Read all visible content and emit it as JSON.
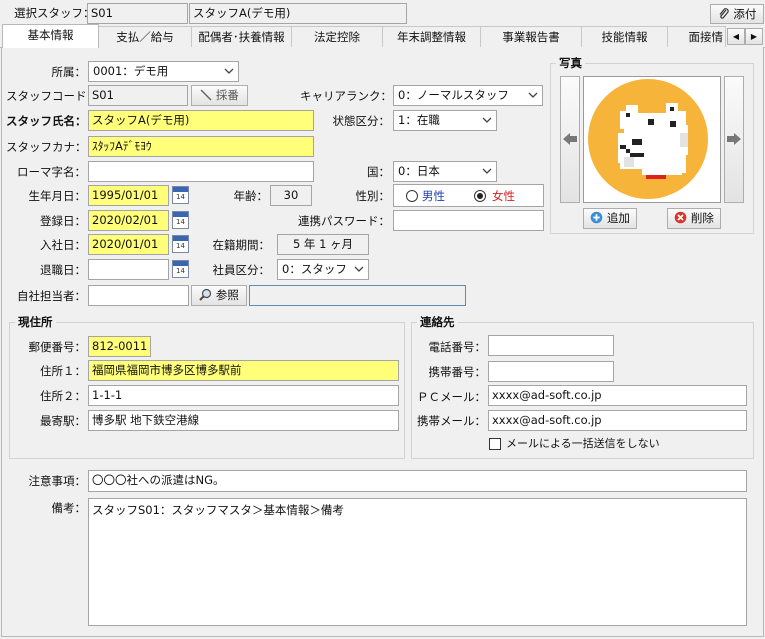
{
  "header": {
    "selected_staff_label": "選択スタッフ：",
    "staff_code": "S01",
    "staff_name": "スタッフA(デモ用)",
    "attach_label": "添付"
  },
  "tabs": [
    {
      "label": "基本情報"
    },
    {
      "label": "支払／給与"
    },
    {
      "label": "配偶者･扶養情報"
    },
    {
      "label": "法定控除"
    },
    {
      "label": "年末調整情報"
    },
    {
      "label": "事業報告書"
    },
    {
      "label": "技能情報"
    },
    {
      "label": "面接情"
    }
  ],
  "form": {
    "affiliation": {
      "label": "所属：",
      "value": "0001：デモ用"
    },
    "staff_code": {
      "label": "スタッフコード：",
      "value": "S01",
      "assign_button": "採番"
    },
    "career_rank": {
      "label": "キャリアランク：",
      "value": "0：ノーマルスタッフ"
    },
    "staff_name": {
      "label": "スタッフ氏名：",
      "value": "スタッフA(デモ用)"
    },
    "status": {
      "label": "状態区分：",
      "value": "1：在職"
    },
    "staff_kana": {
      "label": "スタッフカナ：",
      "value": "ｽﾀｯﾌAﾃﾞﾓﾖｳ"
    },
    "romaji": {
      "label": "ローマ字名：",
      "value": ""
    },
    "country": {
      "label": "国：",
      "value": "0：日本"
    },
    "birthdate": {
      "label": "生年月日：",
      "value": "1995/01/01"
    },
    "age": {
      "label": "年齢：",
      "value": "30"
    },
    "gender": {
      "label": "性別：",
      "male": "男性",
      "female": "女性",
      "selected": "female"
    },
    "registered": {
      "label": "登録日：",
      "value": "2020/02/01"
    },
    "link_password": {
      "label": "連携パスワード：",
      "value": ""
    },
    "joined": {
      "label": "入社日：",
      "value": "2020/01/01"
    },
    "tenure": {
      "label": "在籍期間：",
      "value": "5 年 1 ヶ月"
    },
    "retired": {
      "label": "退職日：",
      "value": ""
    },
    "employee_type": {
      "label": "社員区分：",
      "value": "0：スタッフ"
    },
    "manager": {
      "label": "自社担当者：",
      "value": "",
      "ref_button": "参照",
      "name": ""
    },
    "calendar_icon_text": "14"
  },
  "photo": {
    "title": "写真",
    "add_button": "追加",
    "delete_button": "削除"
  },
  "address": {
    "title": "現住所",
    "postal": {
      "label": "郵便番号：",
      "value": "812-0011"
    },
    "address1": {
      "label": "住所１：",
      "value": "福岡県福岡市博多区博多駅前"
    },
    "address2": {
      "label": "住所２：",
      "value": "1-1-1"
    },
    "station": {
      "label": "最寄駅：",
      "value": "博多駅  地下鉄空港線"
    }
  },
  "contact": {
    "title": "連絡先",
    "phone": {
      "label": "電話番号：",
      "value": ""
    },
    "mobile": {
      "label": "携帯番号：",
      "value": ""
    },
    "pc_mail": {
      "label": "ＰＣメール：",
      "value": "xxxx@ad-soft.co.jp"
    },
    "mobile_mail": {
      "label": "携帯メール：",
      "value": "xxxx@ad-soft.co.jp"
    },
    "no_bulk_mail": {
      "label": "メールによる一括送信をしない",
      "checked": false
    }
  },
  "notes": {
    "caution_label": "注意事項：",
    "caution_value": "〇〇〇社への派遣はNG。",
    "remarks_label": "備考：",
    "remarks_value": "スタッフS01：スタッフマスタ＞基本情報＞備考"
  }
}
